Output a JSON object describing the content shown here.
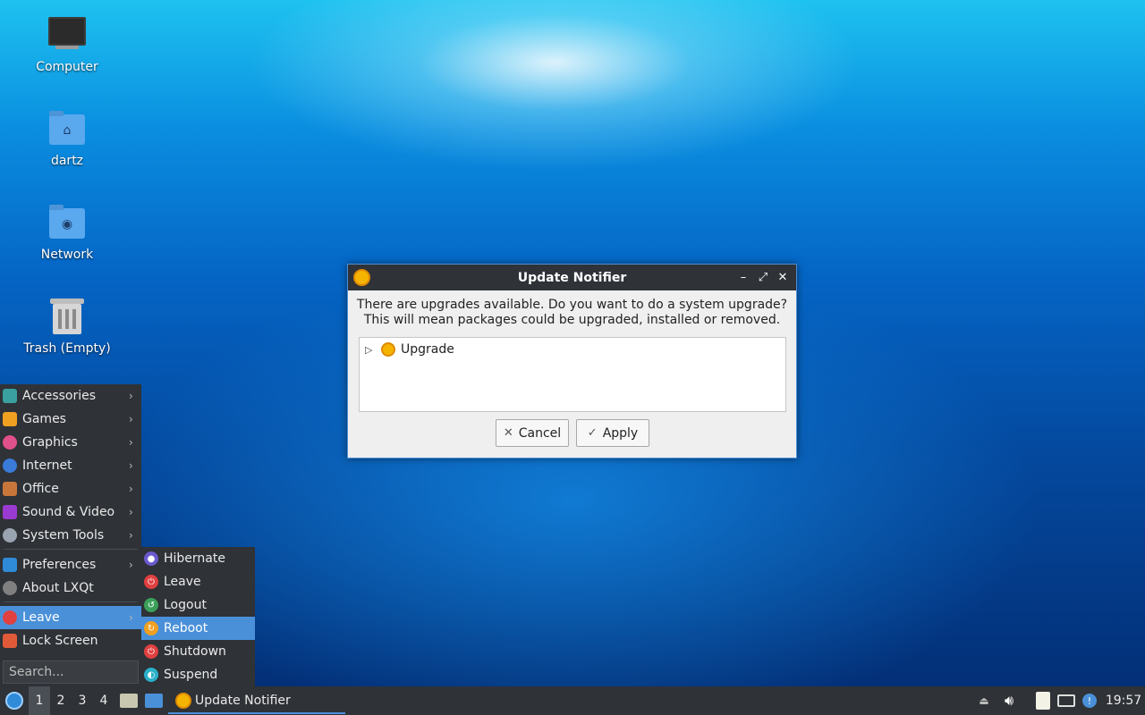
{
  "desktop": {
    "icons": [
      {
        "label": "Computer",
        "icon": "computer-icon"
      },
      {
        "label": "dartz",
        "icon": "home-folder-icon"
      },
      {
        "label": "Network",
        "icon": "network-folder-icon"
      },
      {
        "label": "Trash (Empty)",
        "icon": "trash-icon"
      }
    ]
  },
  "main_menu": {
    "items": [
      {
        "label": "Accessories",
        "icon": "accessories-icon",
        "color": "#3aa0a0"
      },
      {
        "label": "Games",
        "icon": "games-icon",
        "color": "#f0a020"
      },
      {
        "label": "Graphics",
        "icon": "graphics-icon",
        "color": "#e0508a"
      },
      {
        "label": "Internet",
        "icon": "internet-icon",
        "color": "#3a7ad8"
      },
      {
        "label": "Office",
        "icon": "office-icon",
        "color": "#c8763a"
      },
      {
        "label": "Sound & Video",
        "icon": "sound-video-icon",
        "color": "#9a3ad0"
      },
      {
        "label": "System Tools",
        "icon": "system-tools-icon",
        "color": "#9aa4b0"
      },
      {
        "label": "Preferences",
        "icon": "preferences-icon",
        "color": "#2f8ad8"
      },
      {
        "label": "About LXQt",
        "icon": "about-icon",
        "color": "#808080"
      },
      {
        "label": "Leave",
        "icon": "leave-icon",
        "color": "#e04040"
      },
      {
        "label": "Lock Screen",
        "icon": "lock-icon",
        "color": "#e05a3a"
      }
    ],
    "search_placeholder": "Search..."
  },
  "leave_submenu": {
    "items": [
      {
        "label": "Hibernate",
        "icon": "hibernate-icon",
        "color": "#6a5acd"
      },
      {
        "label": "Leave",
        "icon": "power-icon",
        "color": "#e04040"
      },
      {
        "label": "Logout",
        "icon": "logout-icon",
        "color": "#3aa05a"
      },
      {
        "label": "Reboot",
        "icon": "reboot-icon",
        "color": "#f0a020"
      },
      {
        "label": "Shutdown",
        "icon": "shutdown-icon",
        "color": "#e04040"
      },
      {
        "label": "Suspend",
        "icon": "suspend-icon",
        "color": "#2ab0c8"
      }
    ]
  },
  "dialog": {
    "title": "Update Notifier",
    "message_line1": "There are upgrades available. Do you want to do a system upgrade?",
    "message_line2": "This will mean packages could be upgraded, installed or removed.",
    "tree_item": "Upgrade",
    "cancel_label": "Cancel",
    "apply_label": "Apply"
  },
  "taskbar": {
    "desktops": [
      "1",
      "2",
      "3",
      "4"
    ],
    "active_desktop": "1",
    "task_label": "Update Notifier",
    "clock": "19:57"
  },
  "colors": {
    "panel_bg": "#2f3237",
    "accent": "#4a90d9"
  }
}
